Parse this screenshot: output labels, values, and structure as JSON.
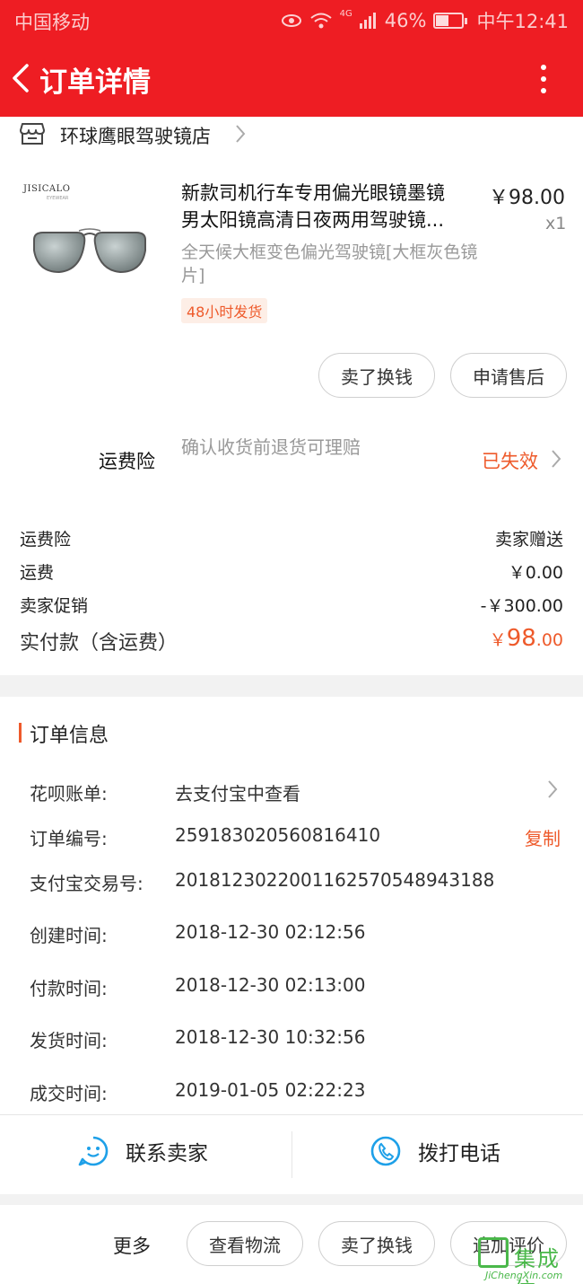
{
  "status_bar": {
    "carrier": "中国移动",
    "network": "4G",
    "battery": "46%",
    "time": "中午12:41"
  },
  "header": {
    "title": "订单详情"
  },
  "store": {
    "name": "环球鹰眼驾驶镜店"
  },
  "product": {
    "brand": "JISICALO",
    "brand_sub": "EYEWEAR",
    "title_line1": "新款司机行车专用偏光眼镜墨镜",
    "title_line2": "男太阳镜高清日夜两用驾驶镜...",
    "price": "￥98.00",
    "quantity": "x1",
    "sku": "全天候大框变色偏光驾驶镜[大框灰色镜片]",
    "shipping_tag": "48小时发货",
    "buttons": {
      "sell": "卖了换钱",
      "after_sale": "申请售后"
    }
  },
  "insurance": {
    "label": "运费险",
    "desc": "确认收货前退货可理赔",
    "status": "已失效"
  },
  "summary": {
    "rows": [
      {
        "label": "运费险",
        "value": "卖家赠送"
      },
      {
        "label": "运费",
        "value": "￥0.00"
      },
      {
        "label": "卖家促销",
        "value": "-￥300.00"
      }
    ],
    "paid_label": "实付款（含运费）",
    "paid_symbol": "￥",
    "paid_int": "98",
    "paid_dec": ".00"
  },
  "order_info": {
    "title": "订单信息",
    "huabei": {
      "label": "花呗账单:",
      "value": "去支付宝中查看"
    },
    "order_no": {
      "label": "订单编号:",
      "value": "259183020560816410",
      "copy": "复制"
    },
    "alipay_no": {
      "label": "支付宝交易号:",
      "value": "2018123022001162570548943188"
    },
    "created": {
      "label": "创建时间:",
      "value": "2018-12-30 02:12:56"
    },
    "paid": {
      "label": "付款时间:",
      "value": "2018-12-30 02:13:00"
    },
    "shipped": {
      "label": "发货时间:",
      "value": "2018-12-30 10:32:56"
    },
    "completed": {
      "label": "成交时间:",
      "value": "2019-01-05 02:22:23"
    }
  },
  "contact": {
    "seller": "联系卖家",
    "phone": "拨打电话"
  },
  "bottom_bar": {
    "more": "更多",
    "logistics": "查看物流",
    "sell": "卖了换钱",
    "review": "追加评价"
  },
  "watermark": {
    "cn": "集成信",
    "en": "JiChengXin.com"
  },
  "colors": {
    "header_red": "#ee1d23",
    "accent_orange": "#ee5a2b",
    "watermark_green": "#4ab84a"
  }
}
